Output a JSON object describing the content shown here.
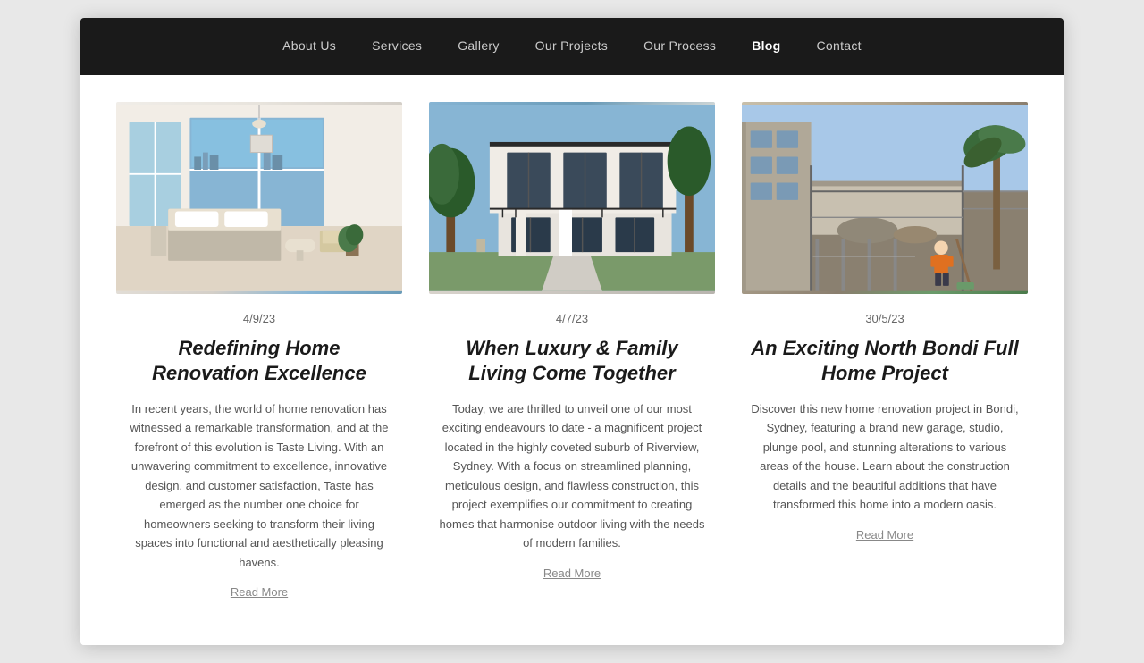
{
  "nav": {
    "items": [
      {
        "label": "About Us",
        "href": "#",
        "active": false
      },
      {
        "label": "Services",
        "href": "#",
        "active": false
      },
      {
        "label": "Gallery",
        "href": "#",
        "active": false
      },
      {
        "label": "Our Projects",
        "href": "#",
        "active": false
      },
      {
        "label": "Our Process",
        "href": "#",
        "active": false
      },
      {
        "label": "Blog",
        "href": "#",
        "active": true
      },
      {
        "label": "Contact",
        "href": "#",
        "active": false
      }
    ]
  },
  "blog": {
    "cards": [
      {
        "date": "4/9/23",
        "title": "Redefining Home Renovation Excellence",
        "excerpt": "In recent years, the world of home renovation has witnessed a remarkable transformation, and at the forefront of this evolution is Taste Living. With an unwavering commitment to excellence, innovative design, and customer satisfaction, Taste has emerged as the number one choice for homeowners seeking to transform their living spaces into functional and aesthetically pleasing havens.",
        "read_more": "Read More",
        "image_type": "bedroom"
      },
      {
        "date": "4/7/23",
        "title": "When Luxury & Family Living Come Together",
        "excerpt": "Today, we are thrilled to unveil one of our most exciting endeavours to date - a magnificent project located in the highly coveted suburb of Riverview, Sydney. With a focus on streamlined planning, meticulous design, and flawless construction, this project exemplifies our commitment to creating homes that harmonise outdoor living with the needs of modern families.",
        "read_more": "Read More",
        "image_type": "house"
      },
      {
        "date": "30/5/23",
        "title": "An Exciting North Bondi Full Home Project",
        "excerpt": "Discover this new home renovation project in Bondi, Sydney, featuring a brand new garage, studio, plunge pool, and stunning alterations to various areas of the house. Learn about the construction details and the beautiful additions that have transformed this home into a modern oasis.",
        "read_more": "Read More",
        "image_type": "construction"
      }
    ]
  }
}
